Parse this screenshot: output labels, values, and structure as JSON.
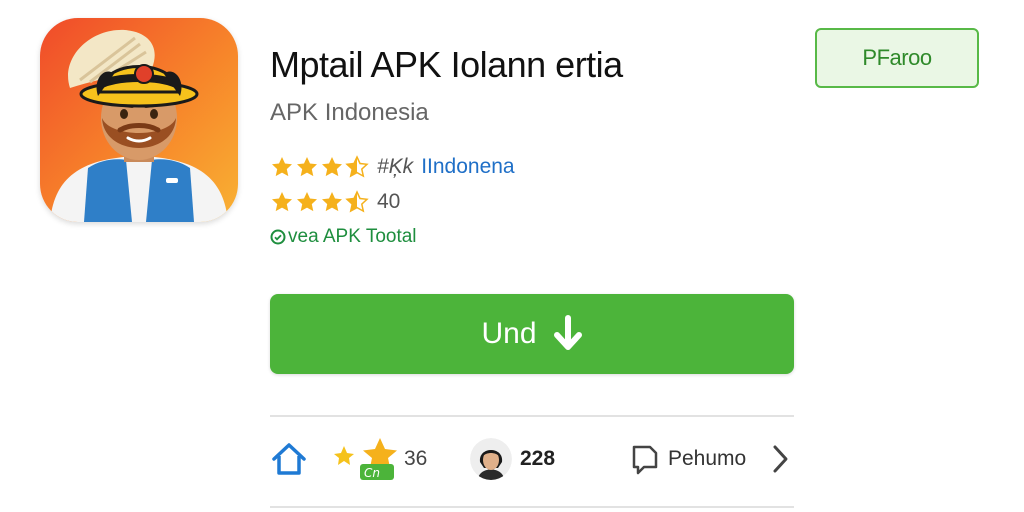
{
  "app": {
    "title": "Mptail APK Iolann ertia",
    "publisher": "APK Indonesia"
  },
  "ratings": [
    {
      "stars": 3.5,
      "label_gray": "#Ķk",
      "label_blue": "IIndonena"
    },
    {
      "stars": 3.5,
      "label_gray": "40",
      "label_blue": ""
    }
  ],
  "verified": {
    "icon": "check-circle-icon",
    "text": "vea APK Tootal"
  },
  "top_button": {
    "label": "PFaroo"
  },
  "install_button": {
    "label": "Und",
    "icon": "download-arrow-icon"
  },
  "bottom_bar": {
    "home_icon": "home-icon",
    "stars_icon": "stars-badge-icon",
    "stars_count": "36",
    "avatar_count": "228",
    "reviews_icon": "bookmark-icon",
    "reviews_label": "Pehumo",
    "next_icon": "chevron-right-icon"
  },
  "colors": {
    "accent_green": "#4cb43a",
    "star_gold": "#f5b11c",
    "link_blue": "#1f6fc7",
    "verified_green": "#1e8e3e"
  }
}
